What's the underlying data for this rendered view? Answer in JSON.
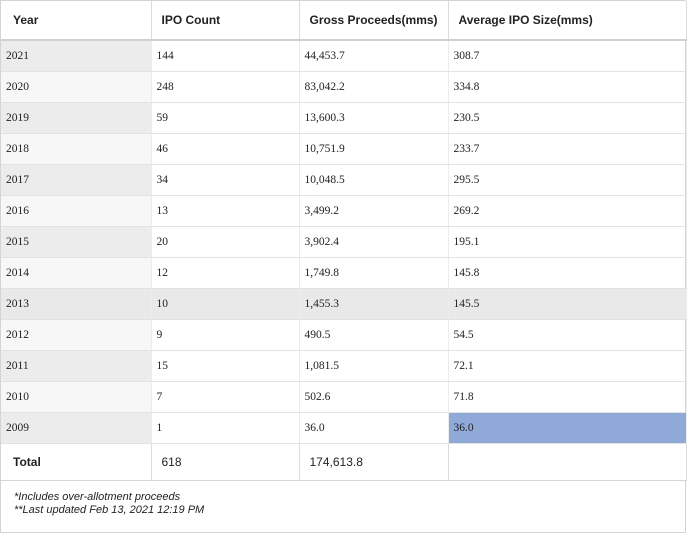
{
  "table": {
    "headers": [
      "Year",
      "IPO Count",
      "Gross Proceeds(mms)",
      "Average IPO Size(mms)"
    ],
    "rows": [
      [
        "2021",
        "144",
        "44,453.7",
        "308.7"
      ],
      [
        "2020",
        "248",
        "83,042.2",
        "334.8"
      ],
      [
        "2019",
        "59",
        "13,600.3",
        "230.5"
      ],
      [
        "2018",
        "46",
        "10,751.9",
        "233.7"
      ],
      [
        "2017",
        "34",
        "10,048.5",
        "295.5"
      ],
      [
        "2016",
        "13",
        "3,499.2",
        "269.2"
      ],
      [
        "2015",
        "20",
        "3,902.4",
        "195.1"
      ],
      [
        "2014",
        "12",
        "1,749.8",
        "145.8"
      ],
      [
        "2013",
        "10",
        "1,455.3",
        "145.5"
      ],
      [
        "2012",
        "9",
        "490.5",
        "54.5"
      ],
      [
        "2011",
        "15",
        "1,081.5",
        "72.1"
      ],
      [
        "2010",
        "7",
        "502.6",
        "71.8"
      ],
      [
        "2009",
        "1",
        "36.0",
        "36.0"
      ]
    ],
    "total": [
      "Total",
      "618",
      "174,613.8",
      ""
    ]
  },
  "notes": {
    "line1": "*Includes over-allotment proceeds",
    "line2": "**Last updated Feb 13, 2021 12:19 PM"
  },
  "colors": {
    "highlight": "#8fa9d9",
    "shaded_row": "#e9e9e9"
  }
}
